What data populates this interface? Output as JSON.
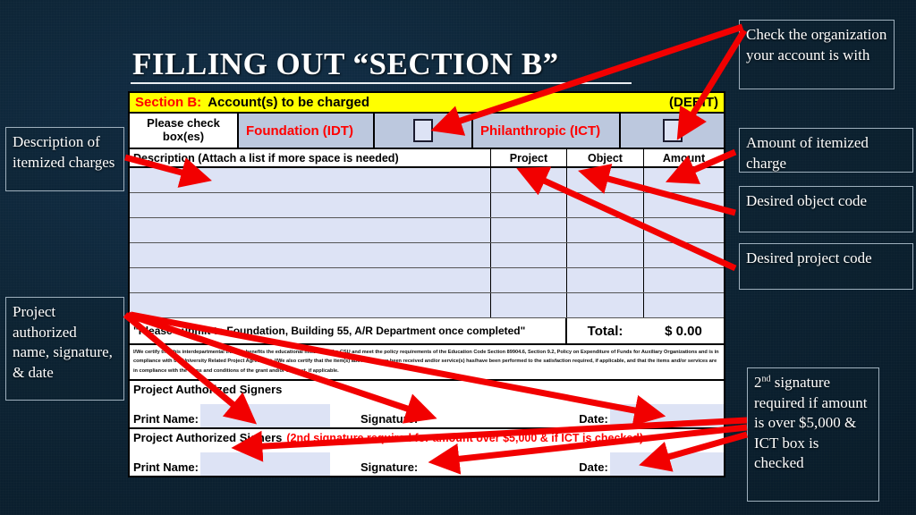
{
  "slide": {
    "title": "FILLING OUT “SECTION B”",
    "background_color": "#0d2435",
    "accent_color": "#ff0000"
  },
  "form": {
    "section_header": {
      "section_label": "Section B:",
      "section_title": "Account(s) to be charged",
      "right_label": "(DEBIT)",
      "background_color": "#ffff00"
    },
    "checkbox_band": {
      "instruction": "Please check box(es)",
      "option_1_label": "Foundation (IDT)",
      "option_1_checked": false,
      "option_2_label": "Philanthropic (ICT)",
      "option_2_checked": false,
      "label_color": "#ff0000",
      "band_color": "#bcc8de"
    },
    "table": {
      "columns": [
        "Description (Attach a list if more space is needed)",
        "Project",
        "Object",
        "Amount"
      ],
      "rows": [
        [
          "",
          "",
          "",
          ""
        ],
        [
          "",
          "",
          "",
          ""
        ],
        [
          "",
          "",
          "",
          ""
        ],
        [
          "",
          "",
          "",
          ""
        ],
        [
          "",
          "",
          "",
          ""
        ],
        [
          "",
          "",
          "",
          ""
        ]
      ],
      "row_count": 6
    },
    "total_row": {
      "note": "\"Please submit to Foundation, Building 55, A/R Department once completed\"",
      "total_label": "Total:",
      "total_value": "$ 0.00"
    },
    "legal_text": "I/We certify that this interdepartmental transfer benefits the educational mission of the CSU and meet the policy requirements of the Education Code Section 89904.6, Section 9.2, Policy on Expenditure of Funds for Auxiliary Organizations and is in compliance with the University Related Project Agreement. I/We also certify that the item(s) above has/have been received and/or service(s) has/have been performed to the satisfaction required, if applicable, and that the items and/or services are in compliance with the terms and conditions of the grant and/or contract, if applicable.",
    "signers": [
      {
        "heading": "Project Authorized Signers",
        "note": "",
        "print_name_label": "Print Name:",
        "signature_label": "Signature:",
        "date_label": "Date:",
        "print_name_value": "",
        "signature_value": "",
        "date_value": ""
      },
      {
        "heading": "Project Authorized Signers",
        "note": "(2nd signature required for amount over $5,000 & if ICT is checked)",
        "print_name_label": "Print Name:",
        "signature_label": "Signature:",
        "date_label": "Date:",
        "print_name_value": "",
        "signature_value": "",
        "date_value": ""
      }
    ]
  },
  "callouts": {
    "description_of_itemized_charges": "Description of itemized charges",
    "project_authorized": "Project authorized name, signature, & date",
    "check_the_organization": "Check the organization your account is with",
    "amount_of_itemized_charge": "Amount of itemized charge",
    "desired_object_code": "Desired object code",
    "desired_project_code": "Desired project code",
    "second_signature_prefix": "2",
    "second_signature_sup": "nd",
    "second_signature_rest": " signature required if amount is over $5,000 & ICT box is checked"
  }
}
